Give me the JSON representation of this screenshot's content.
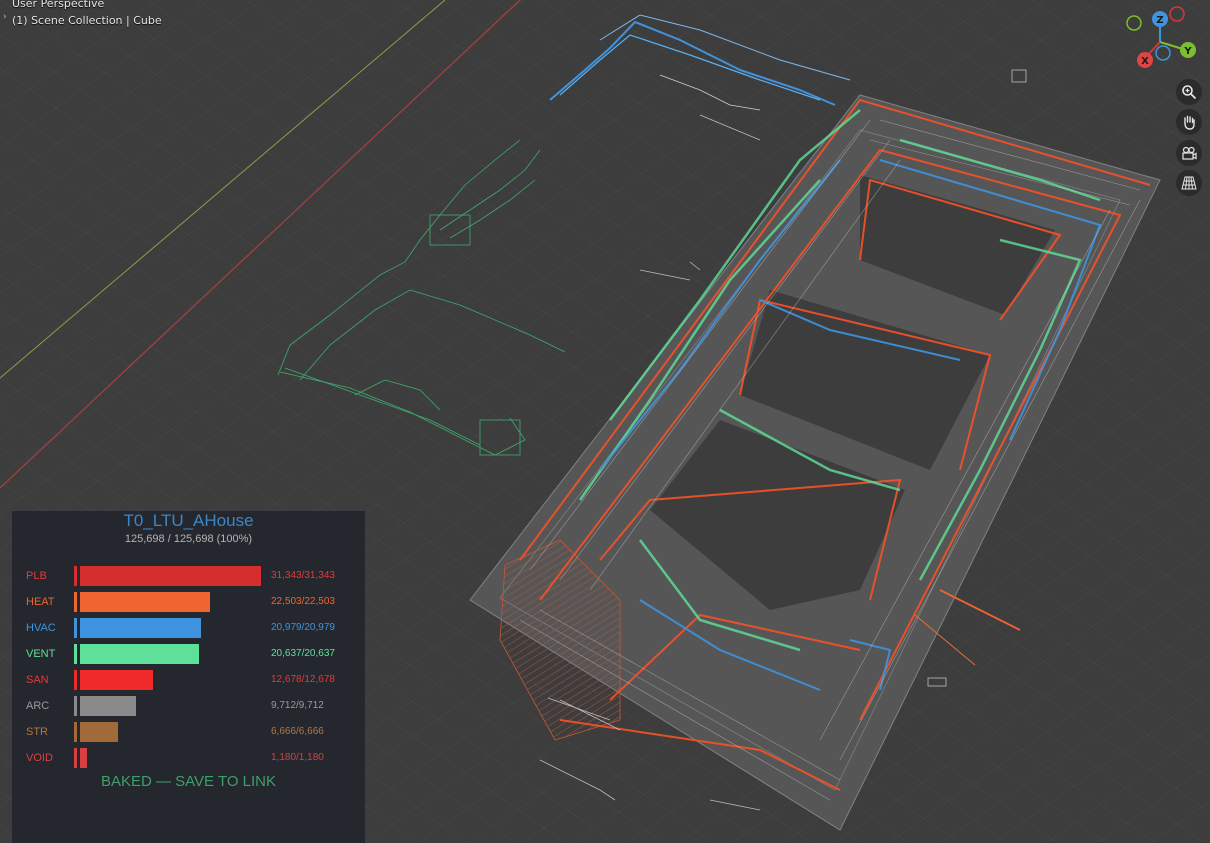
{
  "viewport": {
    "view_label": "User Perspective",
    "collection_label": "(1) Scene Collection | Cube"
  },
  "gizmo": {
    "z": "Z",
    "x": "X",
    "y": "Y"
  },
  "tools": [
    "zoom-icon",
    "hand-pan-icon",
    "camera-icon",
    "grid-perspective-icon"
  ],
  "panel": {
    "title": "T0_LTU_AHouse",
    "count": "125,698 / 125,698  (100%)",
    "status": "BAKED — SAVE TO LINK",
    "categories": [
      {
        "label": "PLB",
        "count": "31,343/31,343",
        "value": 31343,
        "color": "#d42e2e",
        "text_color": "#e03b3b"
      },
      {
        "label": "HEAT",
        "count": "22,503/22,503",
        "value": 22503,
        "color": "#ef6530",
        "text_color": "#ef6530"
      },
      {
        "label": "HVAC",
        "count": "20,979/20,979",
        "value": 20979,
        "color": "#3f94e0",
        "text_color": "#3f94e0"
      },
      {
        "label": "VENT",
        "count": "20,637/20,637",
        "value": 20637,
        "color": "#5fe09a",
        "text_color": "#5fe09a"
      },
      {
        "label": "SAN",
        "count": "12,678/12,678",
        "value": 12678,
        "color": "#f02a2a",
        "text_color": "#e53a3a"
      },
      {
        "label": "ARC",
        "count": "9,712/9,712",
        "value": 9712,
        "color": "#8a8a8a",
        "text_color": "#9a9a9a"
      },
      {
        "label": "STR",
        "count": "6,666/6,666",
        "value": 6666,
        "color": "#a26a38",
        "text_color": "#b07840"
      },
      {
        "label": "VOID",
        "count": "1,180/1,180",
        "value": 1180,
        "color": "#d84040",
        "text_color": "#d84040"
      }
    ]
  }
}
